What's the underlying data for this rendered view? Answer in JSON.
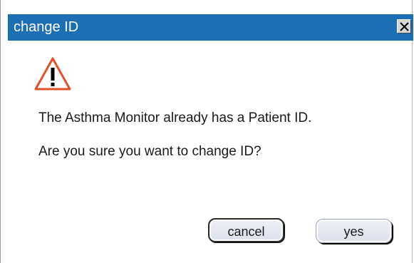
{
  "window": {
    "title": "change ID",
    "close_icon": "close-icon"
  },
  "message": {
    "icon": "warning-triangle-icon",
    "line1": "The Asthma Monitor already has a Patient ID.",
    "line2": "Are you sure you want to change ID?"
  },
  "buttons": {
    "cancel_label": "cancel",
    "yes_label": "yes"
  },
  "colors": {
    "titlebar": "#1d6fb5",
    "warning": "#e0522a"
  }
}
